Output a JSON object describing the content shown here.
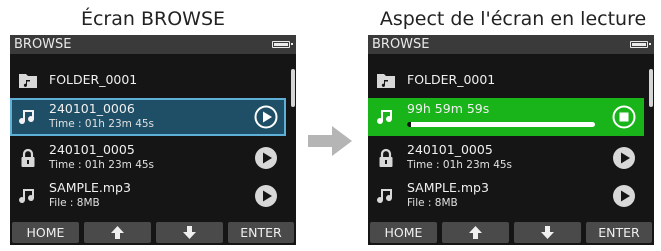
{
  "captions": {
    "left": "Écran BROWSE",
    "right": "Aspect de l'écran en lecture"
  },
  "left_screen": {
    "header": "BROWSE",
    "rows": [
      {
        "icon": "folder-icon",
        "title": "FOLDER_0001"
      },
      {
        "icon": "music-note-icon",
        "title": "240101_0006",
        "subtitle": "Time : 01h 23m 45s",
        "action": "play-icon",
        "state": "selected"
      },
      {
        "icon": "lock-icon",
        "title": "240101_0005",
        "subtitle": "Time : 01h 23m 45s",
        "action": "play-icon"
      },
      {
        "icon": "music-note-icon",
        "title": "SAMPLE.mp3",
        "subtitle": "File : 8MB",
        "action": "play-icon"
      }
    ],
    "buttons": {
      "home": "HOME",
      "up": "up-arrow-icon",
      "down": "down-arrow-icon",
      "enter": "ENTER"
    }
  },
  "right_screen": {
    "header": "BROWSE",
    "rows": [
      {
        "icon": "folder-icon",
        "title": "FOLDER_0001"
      },
      {
        "icon": "music-note-icon",
        "title": "99h 59m 59s",
        "action": "stop-icon",
        "state": "playing",
        "progress": 0.02
      },
      {
        "icon": "lock-icon",
        "title": "240101_0005",
        "subtitle": "Time : 01h 23m 45s",
        "action": "play-icon"
      },
      {
        "icon": "music-note-icon",
        "title": "SAMPLE.mp3",
        "subtitle": "File : 8MB",
        "action": "play-icon"
      }
    ],
    "buttons": {
      "home": "HOME",
      "up": "up-arrow-icon",
      "down": "down-arrow-icon",
      "enter": "ENTER"
    }
  },
  "colors": {
    "screen_bg": "#151515",
    "header_bg": "#3a3a3a",
    "selected_bg": "#1f4f66",
    "selected_border": "#5fb0d8",
    "playing_bg": "#19b419",
    "button_bg": "#4a4a4a",
    "arrow": "#b5b5b5"
  }
}
